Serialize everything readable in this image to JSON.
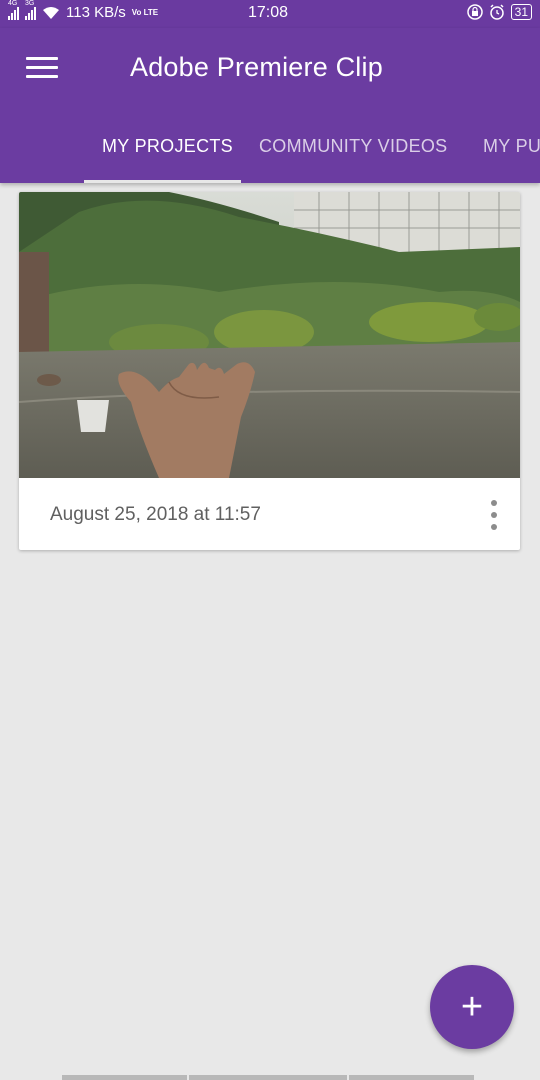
{
  "status_bar": {
    "network_labels": [
      "4G",
      "3G"
    ],
    "speed": "113 KB/s",
    "volte": "Vo LTE",
    "time": "17:08",
    "battery": "31"
  },
  "app_bar": {
    "title": "Adobe Premiere Clip",
    "menu_icon": "hamburger-menu-icon"
  },
  "tabs": [
    {
      "label": "MY PROJECTS",
      "active": true
    },
    {
      "label": "COMMUNITY VIDEOS",
      "active": false
    },
    {
      "label": "MY PU",
      "active": false
    }
  ],
  "projects": [
    {
      "thumbnail": "rainy garden with outstretched hand",
      "date": "August 25, 2018 at 11:57",
      "more_icon": "more-vert-icon"
    }
  ],
  "fab": {
    "icon": "plus-icon",
    "label": "+"
  },
  "colors": {
    "primary": "#6b3ca1",
    "status_bar": "#6a3aa0",
    "background": "#e8e8e8",
    "card": "#ffffff"
  }
}
